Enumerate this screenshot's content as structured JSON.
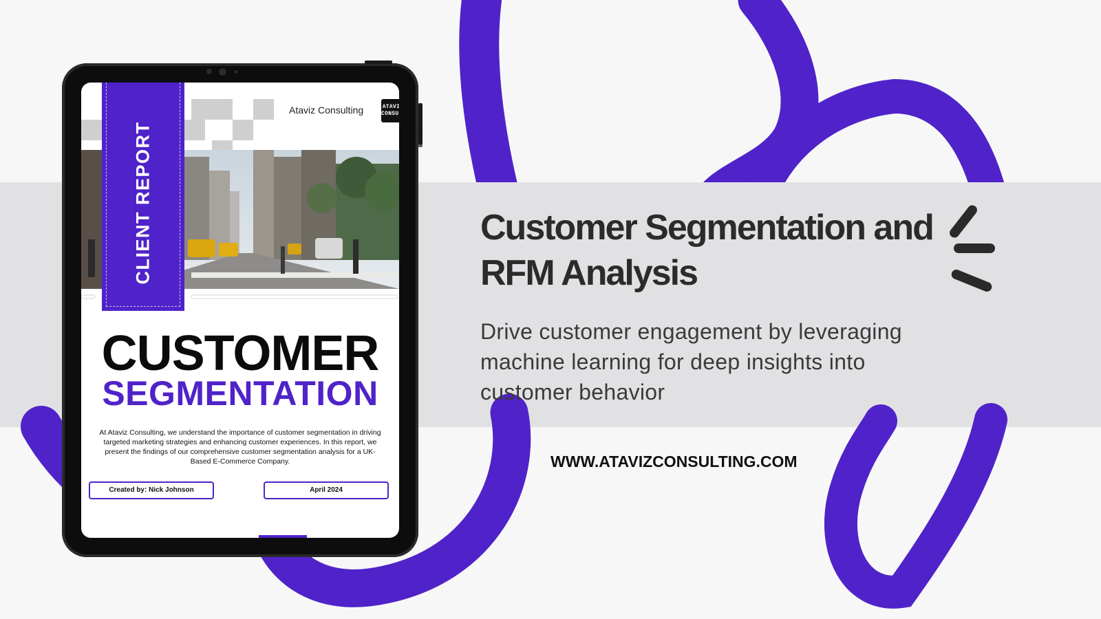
{
  "colors": {
    "accent": "#4f23c9",
    "band": "#e1e1e4",
    "background": "#f7f7f8",
    "heading": "#2b2b2b"
  },
  "hero": {
    "title": "Customer Segmentation and RFM Analysis",
    "subtitle": "Drive customer engagement by leveraging machine learning for deep insights into customer behavior",
    "url": "WWW.ATAVIZCONSULTING.COM"
  },
  "document": {
    "ribbon_label": "CLIENT REPORT",
    "company_name": "Ataviz Consulting",
    "logo_text": "ATAVIZ CONSULTING",
    "title_line1": "CUSTOMER",
    "title_line2": "SEGMENTATION",
    "body": "At Ataviz Consulting, we understand the importance of customer segmentation in driving targeted marketing strategies and enhancing customer experiences. In this report, we present the findings of our comprehensive customer segmentation analysis for a UK-Based E-Commerce Company.",
    "created_by": "Created by: Nick Johnson",
    "date": "April 2024"
  },
  "icons": {
    "decoration": "sparkle-lines-icon",
    "logo": "ataviz-logo-icon"
  }
}
